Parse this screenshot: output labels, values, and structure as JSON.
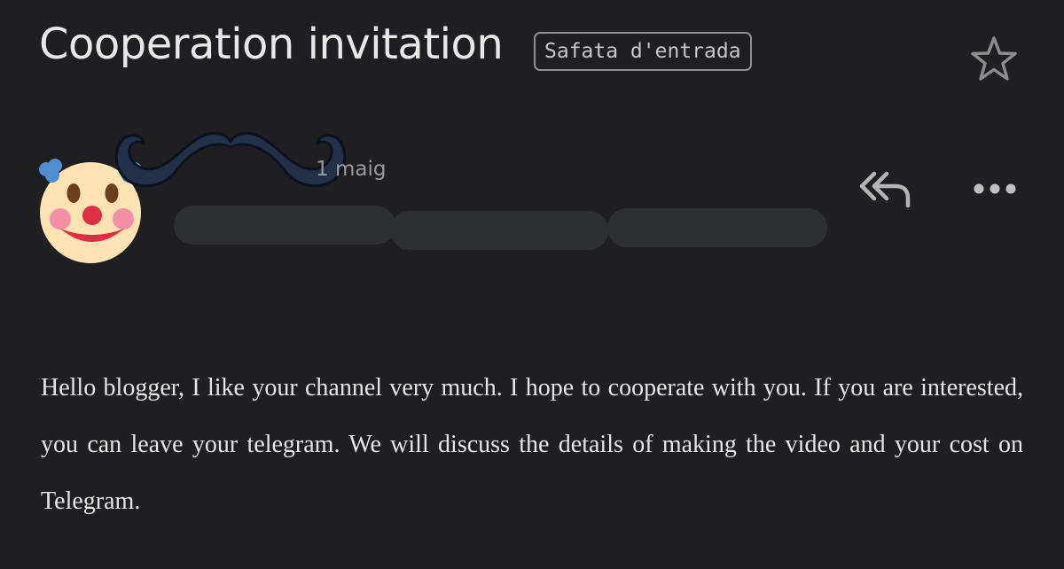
{
  "email": {
    "subject": "Cooperation invitation",
    "label": "Safata d'entrada",
    "sender": {
      "name": "",
      "date": "1 maig"
    },
    "body": "Hello blogger, I like your channel very much. I hope to cooperate with you. If you are interested, you can leave your telegram. We will discuss the details of making the video and your cost on Telegram."
  },
  "icons": {
    "star": "star-outline-icon",
    "reply_all": "reply-all-icon",
    "more": "more-horizontal-icon",
    "avatar": "clown-face-emoji",
    "overlay": "mustache"
  },
  "colors": {
    "background": "#1f1f21",
    "text": "#e3e3e3",
    "muted": "#9a9a9a",
    "redaction": "#2d2f33"
  }
}
